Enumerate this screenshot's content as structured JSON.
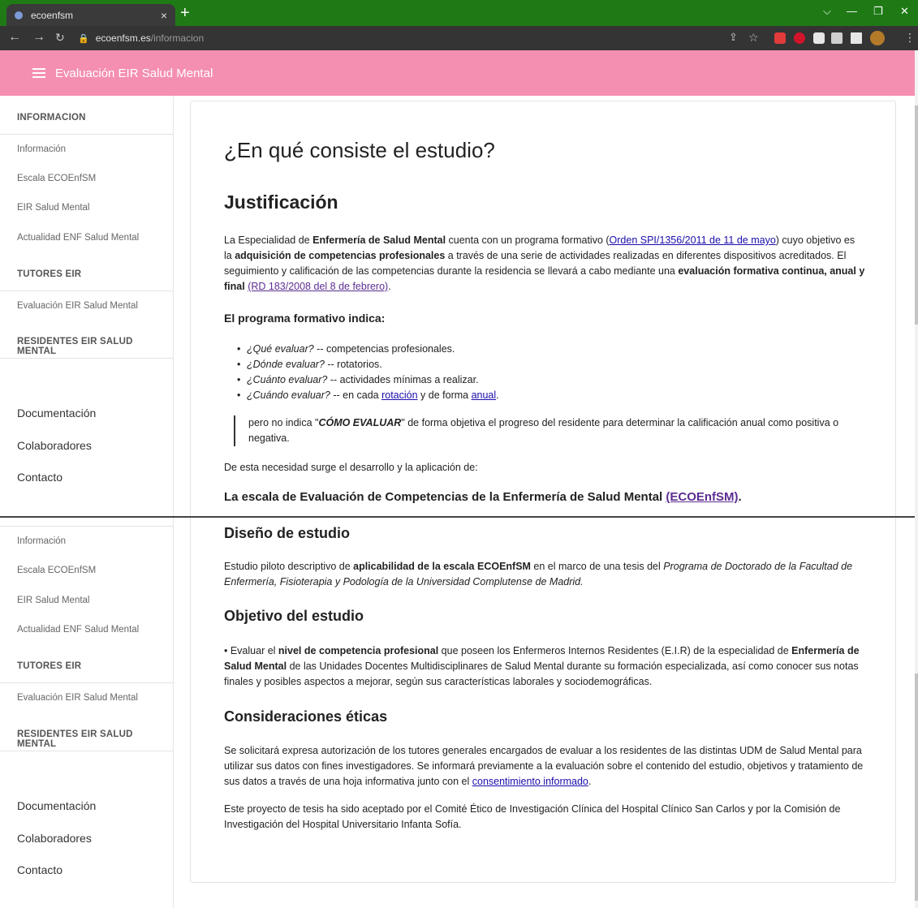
{
  "browser": {
    "tab_title": "ecoenfsm",
    "tab_close": "×",
    "new_tab": "+",
    "url_host": "ecoenfsm.es",
    "url_path": "/informacion",
    "window_min": "—",
    "window_restore": "❐",
    "window_close": "✕",
    "window_chevron": "⌵"
  },
  "header": {
    "title": "Evaluación EIR Salud Mental"
  },
  "sidebar": {
    "top": {
      "informacion_head": "INFORMACION",
      "items": [
        "Información",
        "Escala ECOEnfSM",
        "EIR Salud Mental",
        "Actualidad ENF Salud Mental"
      ],
      "tutores_head": "TUTORES EIR",
      "tutores_item": "Evaluación EIR Salud Mental",
      "residentes_head": "RESIDENTES EIR SALUD MENTAL",
      "links": [
        "Documentación",
        "Colaboradores",
        "Contacto"
      ]
    },
    "bottom": {
      "items": [
        "Información",
        "Escala ECOEnfSM",
        "EIR Salud Mental",
        "Actualidad ENF Salud Mental"
      ],
      "tutores_head": "TUTORES EIR",
      "tutores_item": "Evaluación EIR Salud Mental",
      "residentes_head": "RESIDENTES EIR SALUD MENTAL",
      "links": [
        "Documentación",
        "Colaboradores",
        "Contacto"
      ]
    }
  },
  "content": {
    "page_title": "¿En qué consiste el estudio?",
    "justificacion": {
      "title": "Justificación",
      "p1": [
        "La Especialidad de ",
        "Enfermería de Salud Mental",
        " cuenta con un programa formativo (",
        "Orden SPI/1356/2011 de 11 de mayo",
        ") cuyo objetivo es la ",
        "adquisición de competencias profesionales",
        " a través de una serie de actividades realizadas en diferentes dispositivos acreditados. El seguimiento y calificación de las competencias durante la residencia se llevará a cabo mediante una ",
        "evaluación formativa continua, anual y final",
        " ",
        "(RD 183/2008 del 8 de febrero)",
        "."
      ],
      "programa_head": "El programa formativo indica:",
      "bullets": [
        {
          "q": "¿Qué evaluar?",
          "rest": " -- competencias profesionales."
        },
        {
          "q": "¿Dónde evaluar?",
          "rest": " -- rotatorios."
        },
        {
          "q": "¿Cuánto evaluar?",
          "rest": " -- actividades mínimas a realizar."
        }
      ],
      "bullet4": {
        "q": "¿Cuándo evaluar?",
        "pre": " -- en cada ",
        "link1": "rotación",
        "mid": " y de forma ",
        "link2": "anual",
        "post": "."
      },
      "quote": [
        "pero no indica \"",
        "CÓMO EVALUAR",
        "\" de forma objetiva el progreso del residente para determinar la calificación anual como positiva o negativa."
      ],
      "necesidad": "De esta necesidad surge el desarrollo y la aplicación de:",
      "scale": [
        "La escala de Evaluación de Competencias de la Enfermería de Salud Mental ",
        "(ECOEnfSM)",
        "."
      ]
    },
    "diseno": {
      "title": "Diseño de estudio",
      "p": [
        "Estudio piloto descriptivo de ",
        "aplicabilidad de la escala ECOEnfSM",
        " en el marco de una tesis del ",
        "Programa de Doctorado de la Facultad de Enfermería, Fisioterapia y Podología de la Universidad Complutense de Madrid."
      ]
    },
    "objetivo": {
      "title": "Objetivo del estudio",
      "p": [
        "• Evaluar el ",
        "nivel de competencia profesional",
        " que poseen los Enfermeros Internos Residentes (E.I.R) de la especialidad de ",
        "Enfermería de Salud Mental",
        " de las Unidades Docentes Multidisciplinares de Salud Mental durante su formación especializada, así como conocer sus notas finales y posibles aspectos a mejorar, según sus características laborales y sociodemográficas."
      ]
    },
    "eticas": {
      "title": "Consideraciones éticas",
      "p1": [
        "Se solicitará expresa autorización de los tutores generales encargados de evaluar a los residentes de las distintas UDM de Salud Mental para utilizar sus datos con fines investigadores. Se informará previamente a la evaluación sobre el contenido del estudio, objetivos y tratamiento de sus datos a través de una hoja informativa junto con el ",
        "consentimiento informado",
        "."
      ],
      "p2": "Este proyecto de tesis ha sido aceptado por el Comité Ético de Investigación Clínica del Hospital Clínico San Carlos y por la Comisión de Investigación del Hospital Universitario Infanta Sofía."
    }
  },
  "colors": {
    "header": "#f48fb1",
    "tabbar": "#1f7a16",
    "link": "#1a0dab",
    "visited": "#5c2d91"
  }
}
